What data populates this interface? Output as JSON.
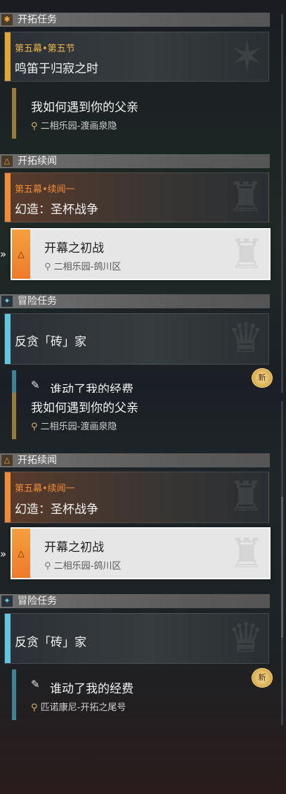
{
  "frame1": {
    "trailblaze": {
      "header": "开拓任务",
      "card": {
        "chapter": "第五幕•第五节",
        "title": "鸣笛于归寂之时"
      },
      "child": {
        "title": "我如何遇到你的父亲",
        "location": "二相乐园-渡画泉隐"
      }
    },
    "continuance": {
      "header": "开拓续闻",
      "card": {
        "chapter": "第五幕•续闻一",
        "title": "幻造：圣杯战争"
      },
      "child": {
        "title": "开幕之初战",
        "location": "二相乐园-鸽川区"
      }
    },
    "adventure": {
      "header": "冒险任务",
      "card": {
        "title": "反贪「砖」家"
      },
      "child": {
        "title": "谁动了我的经费"
      },
      "badge": "新"
    }
  },
  "frame2": {
    "trailblaze_child": {
      "title": "我如何遇到你的父亲",
      "location": "二相乐园-渡画泉隐"
    },
    "continuance": {
      "header": "开拓续闻",
      "card": {
        "chapter": "第五幕•续闻一",
        "title": "幻造：圣杯战争"
      },
      "child": {
        "title": "开幕之初战",
        "location": "二相乐园-鸽川区"
      }
    },
    "adventure": {
      "header": "冒险任务",
      "card": {
        "title": "反贪「砖」家"
      },
      "child": {
        "title": "谁动了我的经费",
        "location": "匹诺康尼-开拓之尾号"
      },
      "badge": "新"
    }
  },
  "icons": {
    "trailblaze": "sparkle-icon",
    "continuance": "triangle-icon",
    "adventure": "diamond-icon",
    "pin": "location-pin-icon",
    "arrow": "double-chevron-icon",
    "quest": "quest-icon"
  },
  "colors": {
    "gold": "#e0a535",
    "orange": "#ee8a38",
    "cyan": "#5cc7df",
    "teal": "#3f8195",
    "brown": "#9a7a3a"
  }
}
